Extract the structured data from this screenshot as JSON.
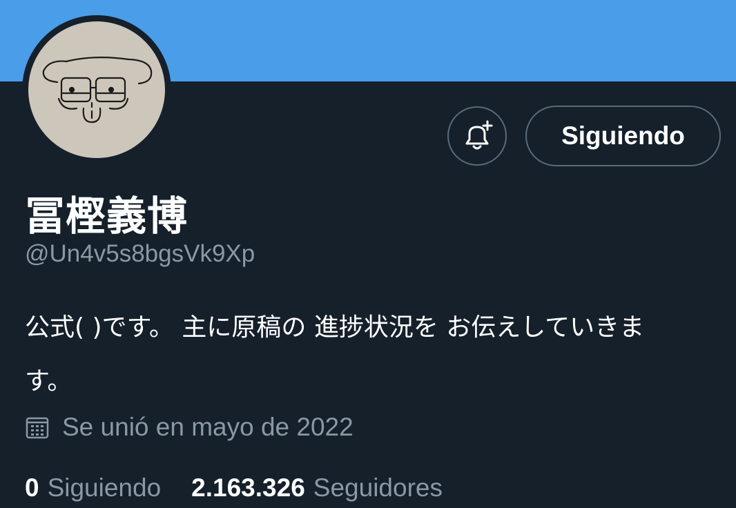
{
  "profile": {
    "display_name": "冨樫義博",
    "handle": "@Un4v5s8bgsVk9Xp",
    "bio_line1": "公式( )です。 主に原稿の 進捗状況を お伝えしていきま",
    "bio_line2": "す。",
    "joined": "Se unió en mayo de 2022"
  },
  "actions": {
    "follow_label": "Siguiendo",
    "notify_icon": "bell-plus-icon"
  },
  "stats": {
    "following_count": "0",
    "following_label": "Siguiendo",
    "followers_count": "2.163.326",
    "followers_label": "Seguidores"
  },
  "colors": {
    "banner": "#4a9de8",
    "background": "#15202b",
    "secondary_text": "#8b98a5",
    "button_border": "#5b6b7a"
  }
}
